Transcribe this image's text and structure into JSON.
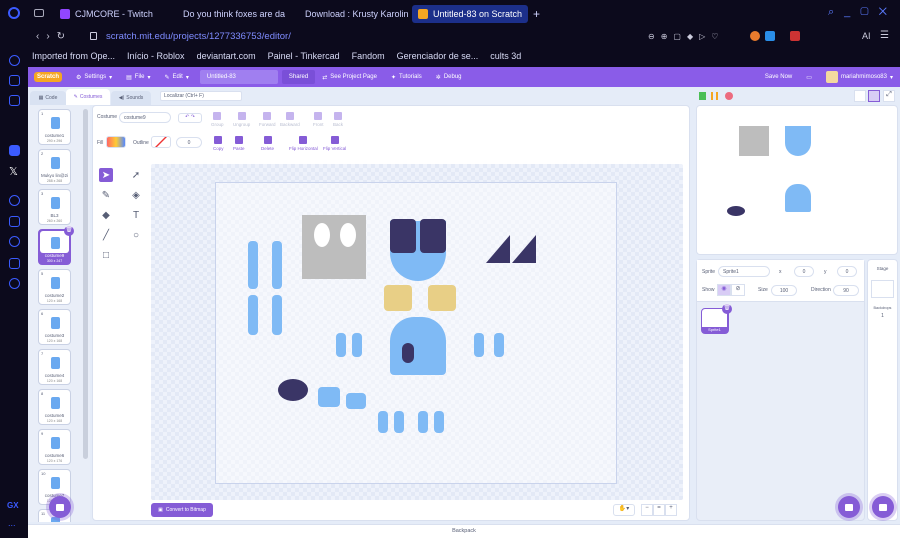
{
  "browser": {
    "tabs": [
      {
        "label": "CJMCORE - Twitch",
        "color": "#9146ff"
      },
      {
        "label": "Do you think foxes are da",
        "color": "#ff0000"
      },
      {
        "label": "Download : Krusty Karolin",
        "color": "#f5c400"
      },
      {
        "label": "Untitled-83 on Scratch",
        "color": "#f5a623"
      }
    ],
    "new_tab": "+",
    "url": "scratch.mit.edu/projects/1277336753/editor/",
    "ai_label": "AI",
    "bookmarks": [
      "Imported from Ope...",
      "Início - Roblox",
      "deviantart.com",
      "Painel - Tinkercad",
      "Fandom",
      "Gerenciador de se...",
      "cults 3d"
    ],
    "sidebar_labels": [
      "GX",
      "..."
    ]
  },
  "menu": {
    "logo": "Scratch",
    "settings": "Settings",
    "file": "File",
    "edit": "Edit",
    "project_title": "Untitled-83",
    "shared": "Shared",
    "see_project_page": "See Project Page",
    "tutorials": "Tutorials",
    "debug": "Debug",
    "save_now": "Save Now",
    "username": "mariahmimoso83"
  },
  "tabs": {
    "code": "Code",
    "costumes": "Costumes",
    "sounds": "Sounds",
    "search_placeholder": "Localizar (Ctrl+ F)"
  },
  "costumes": [
    {
      "num": "1",
      "name": "costume1",
      "size": "290 x 296"
    },
    {
      "num": "2",
      "name": "Mukyo lin@2i",
      "size": "288 x 268"
    },
    {
      "num": "3",
      "name": "BL3",
      "size": "260 x 260"
    },
    {
      "num": "4",
      "name": "costume9",
      "size": "300 x 247",
      "selected": true
    },
    {
      "num": "5",
      "name": "costume2",
      "size": "120 x 168"
    },
    {
      "num": "6",
      "name": "costume3",
      "size": "120 x 168"
    },
    {
      "num": "7",
      "name": "costume4",
      "size": "120 x 168"
    },
    {
      "num": "8",
      "name": "costume5",
      "size": "120 x 168"
    },
    {
      "num": "9",
      "name": "costume6",
      "size": "120 x 176"
    },
    {
      "num": "10",
      "name": "costume7",
      "size": "120 x 176"
    },
    {
      "num": "11",
      "name": "",
      "size": ""
    }
  ],
  "editor": {
    "costume_label": "Costume",
    "costume_name": "costume9",
    "fill_label": "Fill",
    "outline_label": "Outline",
    "outline_width": "0",
    "group": "Group",
    "ungroup": "Ungroup",
    "forward": "Forward",
    "backward": "Backward",
    "front": "Front",
    "back": "Back",
    "copy": "Copy",
    "paste": "Paste",
    "delete": "Delete",
    "flip_h": "Flip Horizontal",
    "flip_v": "Flip Vertical",
    "convert": "Convert to Bitmap",
    "zoom_reset": "="
  },
  "sprite": {
    "sprite_label": "Sprite",
    "name": "Sprite1",
    "x_label": "x",
    "x": "0",
    "y_label": "y",
    "y": "0",
    "show_label": "Show",
    "size_label": "Size",
    "size": "100",
    "direction_label": "Direction",
    "direction": "90",
    "thumb_name": "Sprite1"
  },
  "stage": {
    "label": "Stage",
    "backdrops_label": "Backdrops",
    "backdrops": "1"
  },
  "backpack": "Backpack",
  "colors": {
    "accent": "#855cd6",
    "bluey": "#7fbaf5",
    "dark": "#3a3566"
  }
}
